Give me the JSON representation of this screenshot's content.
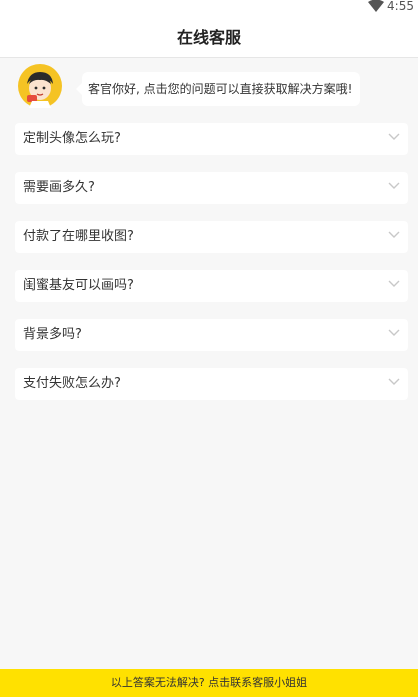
{
  "status_bar": {
    "time": "4:55",
    "wifi_icon": "wifi-icon"
  },
  "header": {
    "title": "在线客服"
  },
  "greeting": {
    "avatar_icon": "cartoon-agent-avatar",
    "message": "客官你好, 点击您的问题可以直接获取解决方案哦!"
  },
  "faq": [
    {
      "question": "定制头像怎么玩?"
    },
    {
      "question": "需要画多久?"
    },
    {
      "question": "付款了在哪里收图?"
    },
    {
      "question": "闺蜜基友可以画吗?"
    },
    {
      "question": "背景多吗?"
    },
    {
      "question": "支付失败怎么办?"
    }
  ],
  "footer": {
    "label": "以上答案无法解决? 点击联系客服小姐姐",
    "color": "#ffe100"
  }
}
